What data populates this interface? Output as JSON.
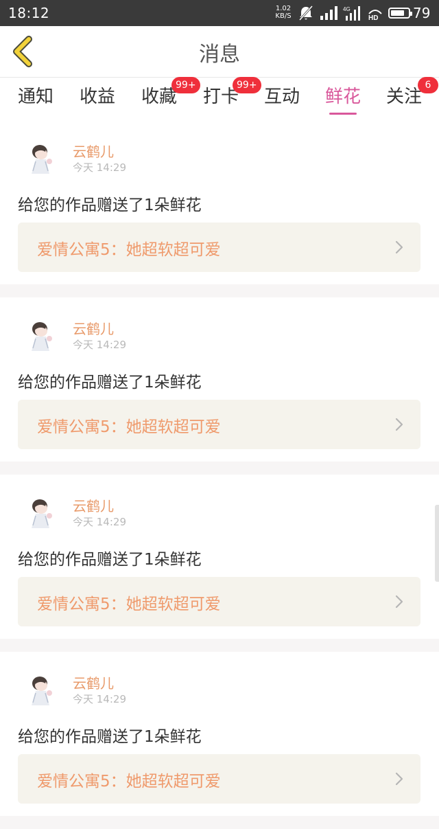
{
  "status_bar": {
    "time": "18:12",
    "net_speed_value": "1.02",
    "net_speed_unit": "KB/S",
    "battery_level": "79",
    "icons": [
      "mute-icon",
      "signal-icon",
      "4g-signal-icon",
      "hd-icon",
      "battery-icon"
    ]
  },
  "header": {
    "title": "消息",
    "back_icon": "chevron-left-icon"
  },
  "tabs": [
    {
      "label": "通知",
      "badge": ""
    },
    {
      "label": "收益",
      "badge": ""
    },
    {
      "label": "收藏",
      "badge": "99+"
    },
    {
      "label": "打卡",
      "badge": "99+"
    },
    {
      "label": "互动",
      "badge": ""
    },
    {
      "label": "鲜花",
      "badge": "",
      "active": true
    },
    {
      "label": "关注",
      "badge": "6"
    }
  ],
  "messages": [
    {
      "sender": "云鹤儿",
      "time": "今天  14:29",
      "text": "给您的作品赠送了1朵鲜花",
      "work_title": "爱情公寓5：她超软超可爱"
    },
    {
      "sender": "云鹤儿",
      "time": "今天  14:29",
      "text": "给您的作品赠送了1朵鲜花",
      "work_title": "爱情公寓5：她超软超可爱"
    },
    {
      "sender": "云鹤儿",
      "time": "今天  14:29",
      "text": "给您的作品赠送了1朵鲜花",
      "work_title": "爱情公寓5：她超软超可爱"
    },
    {
      "sender": "云鹤儿",
      "time": "今天  14:29",
      "text": "给您的作品赠送了1朵鲜花",
      "work_title": "爱情公寓5：她超软超可爱"
    }
  ],
  "colors": {
    "accent": "#d9589b",
    "badge": "#ef2f3b",
    "sender": "#e89a6a",
    "work_title": "#ef9a6c",
    "work_bg": "#f5f3ec",
    "back_icon": "#f2d23a"
  }
}
